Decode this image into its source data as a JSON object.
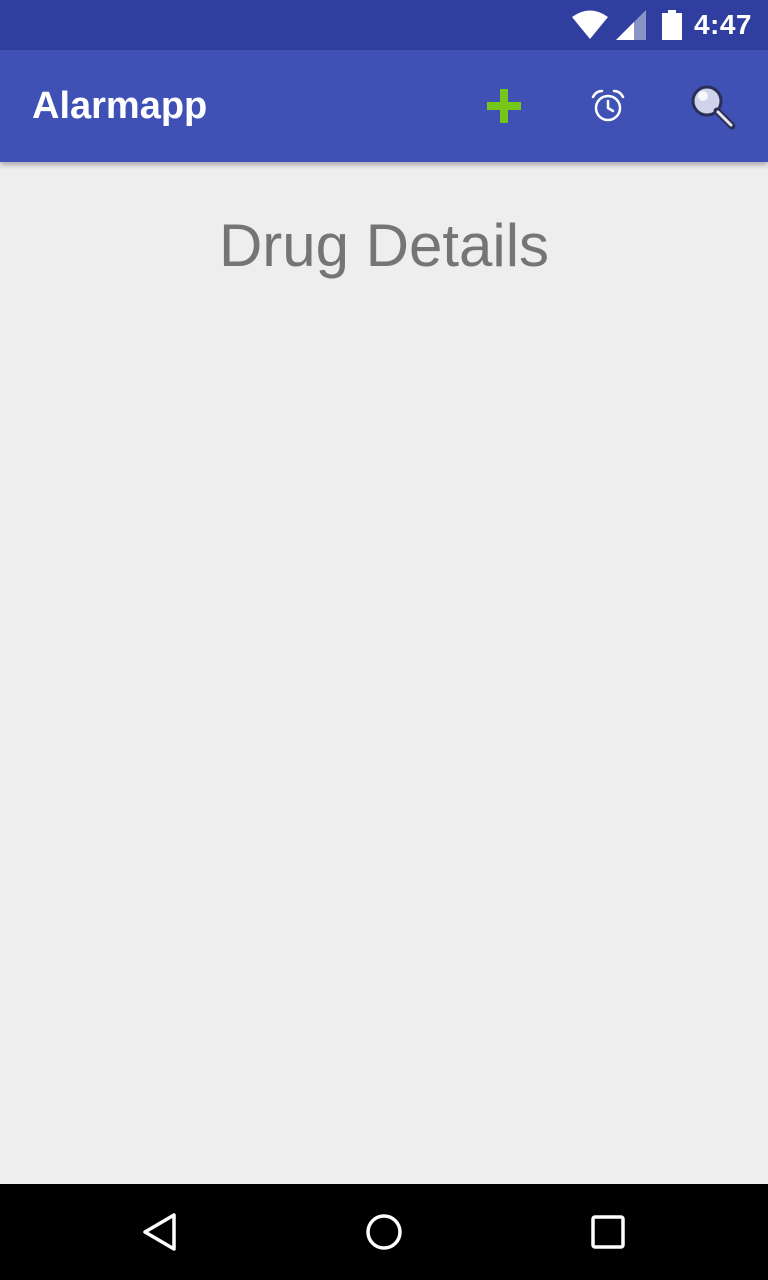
{
  "status_bar": {
    "time": "4:47",
    "icons": [
      "wifi-icon",
      "cell-signal-icon",
      "battery-icon"
    ]
  },
  "app_bar": {
    "title": "Alarmapp",
    "actions": [
      {
        "name": "add",
        "icon": "plus-icon",
        "color": "#76c61a"
      },
      {
        "name": "alarm",
        "icon": "alarm-clock-icon",
        "color": "#ffffff"
      },
      {
        "name": "search",
        "icon": "magnifier-icon",
        "color": "#e8e8f0"
      }
    ]
  },
  "main": {
    "title": "Drug Details"
  },
  "nav_bar": {
    "buttons": [
      "back-triangle-icon",
      "home-circle-icon",
      "recents-square-icon"
    ]
  },
  "colors": {
    "status_bar": "#303f9f",
    "app_bar": "#3f51b5",
    "background": "#eeeeee",
    "title_text": "#757575",
    "nav_bar": "#000000",
    "add_icon": "#76c61a"
  }
}
